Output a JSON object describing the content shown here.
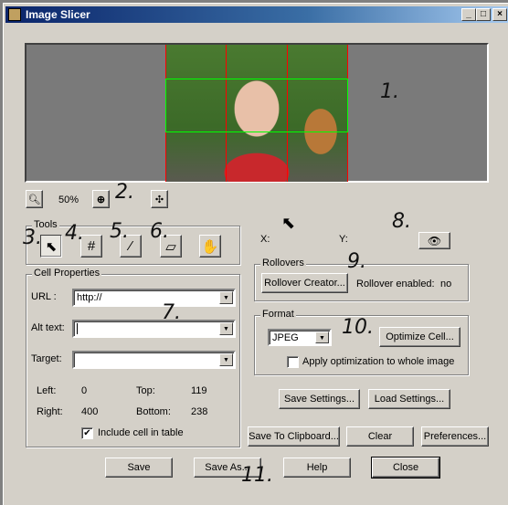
{
  "window": {
    "title": "Image Slicer",
    "minimize": "_",
    "maximize": "□",
    "close": "×"
  },
  "zoom": {
    "level": "50%"
  },
  "annotations": [
    "1.",
    "2.",
    "3.",
    "4.",
    "5.",
    "6.",
    "7.",
    "8.",
    "9.",
    "10.",
    "11."
  ],
  "tools": {
    "label": "Tools",
    "items": [
      {
        "name": "select",
        "glyph": "⬉"
      },
      {
        "name": "slice-grid",
        "glyph": "#"
      },
      {
        "name": "knife",
        "glyph": "⁄"
      },
      {
        "name": "eraser",
        "glyph": "▱"
      },
      {
        "name": "hand",
        "glyph": "✋"
      }
    ]
  },
  "coords": {
    "x_label": "X:",
    "y_label": "Y:"
  },
  "rollovers": {
    "label": "Rollovers",
    "creator_button": "Rollover Creator...",
    "enabled_label": "Rollover enabled:",
    "enabled_value": "no"
  },
  "cell": {
    "label": "Cell Properties",
    "url_label": "URL :",
    "url_value": "http://",
    "alt_label": "Alt text:",
    "alt_value": "",
    "target_label": "Target:",
    "target_value": "",
    "left_label": "Left:",
    "left": "0",
    "top_label": "Top:",
    "top": "119",
    "right_label": "Right:",
    "right": "400",
    "bottom_label": "Bottom:",
    "bottom": "238",
    "include_label": "Include cell in table",
    "include_checked": true
  },
  "format": {
    "label": "Format",
    "selected": "JPEG",
    "optimize_button": "Optimize Cell...",
    "apply_label": "Apply optimization to whole image",
    "apply_checked": false
  },
  "buttons": {
    "save_settings": "Save Settings...",
    "load_settings": "Load Settings...",
    "save_clipboard": "Save To Clipboard...",
    "clear": "Clear",
    "preferences": "Preferences...",
    "save": "Save",
    "save_as": "Save As...",
    "help": "Help",
    "close": "Close"
  },
  "colors": {
    "slice_vertical": "#ff0000",
    "slice_selected": "#00ff00",
    "title_bar": "#0a246a"
  }
}
